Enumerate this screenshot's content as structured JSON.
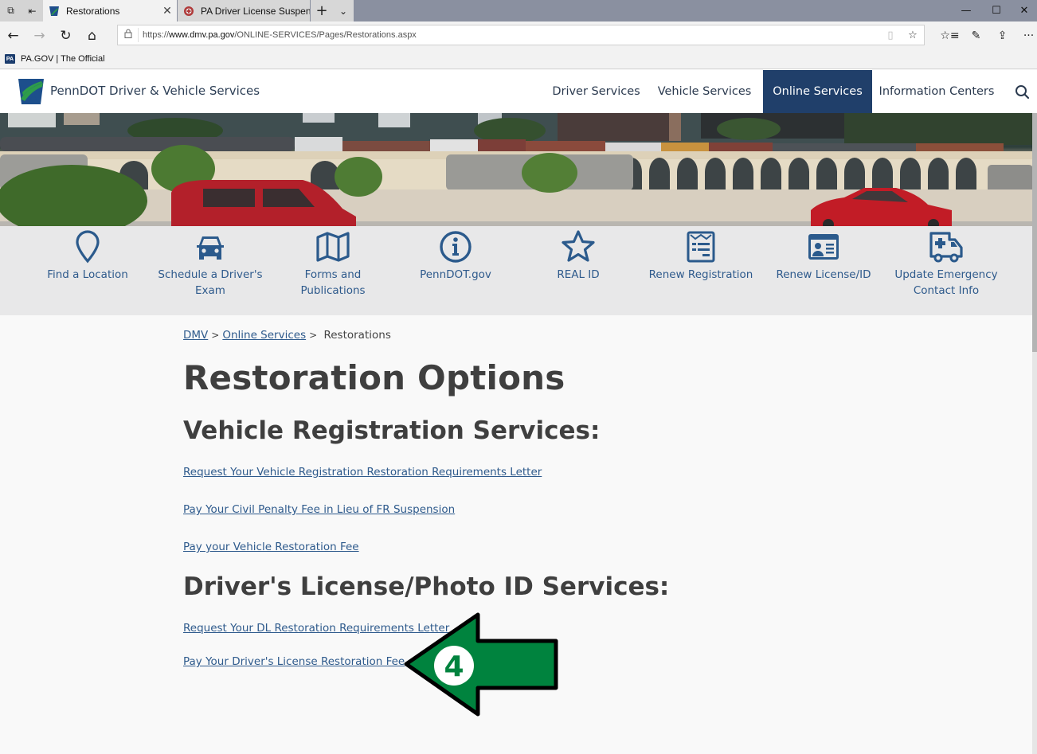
{
  "browser": {
    "tabs": [
      {
        "label": "Restorations",
        "active": true
      },
      {
        "label": "PA Driver License Suspende",
        "active": false
      }
    ],
    "address_bar": {
      "url_prefix": "https://",
      "url_host": "www.dmv.pa.gov",
      "url_path": "/ONLINE-SERVICES/Pages/Restorations.aspx"
    },
    "favorites": [
      {
        "label": "PA.GOV | The Official",
        "icon_text": "PA"
      }
    ],
    "icons": {
      "tab_manager": "⧉",
      "set_aside": "⇤",
      "close": "✕",
      "new_tab": "+",
      "tab_list": "⌄",
      "back": "←",
      "forward": "→",
      "refresh": "↻",
      "home": "⌂",
      "lock": "🔒",
      "reading": "▯",
      "favorite": "☆",
      "favorites_hub": "☆≡",
      "notes": "✎",
      "share": "⇪",
      "more": "···",
      "minimize": "—",
      "maximize": "☐",
      "window_close": "✕"
    }
  },
  "site": {
    "title": "PennDOT Driver & Vehicle Services",
    "nav": [
      {
        "label": "Driver Services",
        "active": false
      },
      {
        "label": "Vehicle Services",
        "active": false
      },
      {
        "label": "Online Services",
        "active": true
      },
      {
        "label": "Information Centers",
        "active": false
      }
    ],
    "colors": {
      "brand_navy": "#203f6a",
      "link_blue": "#2e5a8c",
      "heading_gray": "#3f3f3f",
      "annotation_green": "#00833e"
    }
  },
  "quick_links": [
    {
      "icon": "map-pin-icon",
      "label_lines": [
        "Find a Location",
        ""
      ]
    },
    {
      "icon": "car-icon",
      "label_lines": [
        "Schedule a Driver's",
        "Exam"
      ]
    },
    {
      "icon": "map-icon",
      "label_lines": [
        "Forms and",
        "Publications"
      ]
    },
    {
      "icon": "info-circle-icon",
      "label_lines": [
        "PennDOT.gov",
        ""
      ]
    },
    {
      "icon": "star-icon",
      "label_lines": [
        "REAL ID",
        ""
      ]
    },
    {
      "icon": "registration-document-icon",
      "label_lines": [
        "Renew Registration",
        ""
      ]
    },
    {
      "icon": "id-card-icon",
      "label_lines": [
        "Renew License/ID",
        ""
      ]
    },
    {
      "icon": "ambulance-icon",
      "label_lines": [
        "Update Emergency",
        "Contact Info"
      ]
    }
  ],
  "breadcrumb": {
    "items": [
      {
        "label": "DMV",
        "link": true
      },
      {
        "label": "Online Services",
        "link": true
      },
      {
        "label": "Restorations",
        "link": false
      }
    ],
    "separator": ">"
  },
  "content": {
    "title": "Restoration Options",
    "sections": [
      {
        "heading": "Vehicle Registration Services:",
        "links": [
          "Request Your Vehicle Registration Restoration Requirements Letter",
          "Pay Your Civil Penalty Fee in Lieu of FR Suspension",
          "Pay your Vehicle Restoration Fee"
        ]
      },
      {
        "heading": "Driver's License/Photo ID Services:",
        "links": [
          "Request Your DL Restoration Requirements Letter",
          "Pay Your Driver's License Restoration Fee"
        ]
      }
    ]
  },
  "annotation": {
    "step_number": "4",
    "pointing_to": "Pay Your Driver's License Restoration Fee"
  }
}
